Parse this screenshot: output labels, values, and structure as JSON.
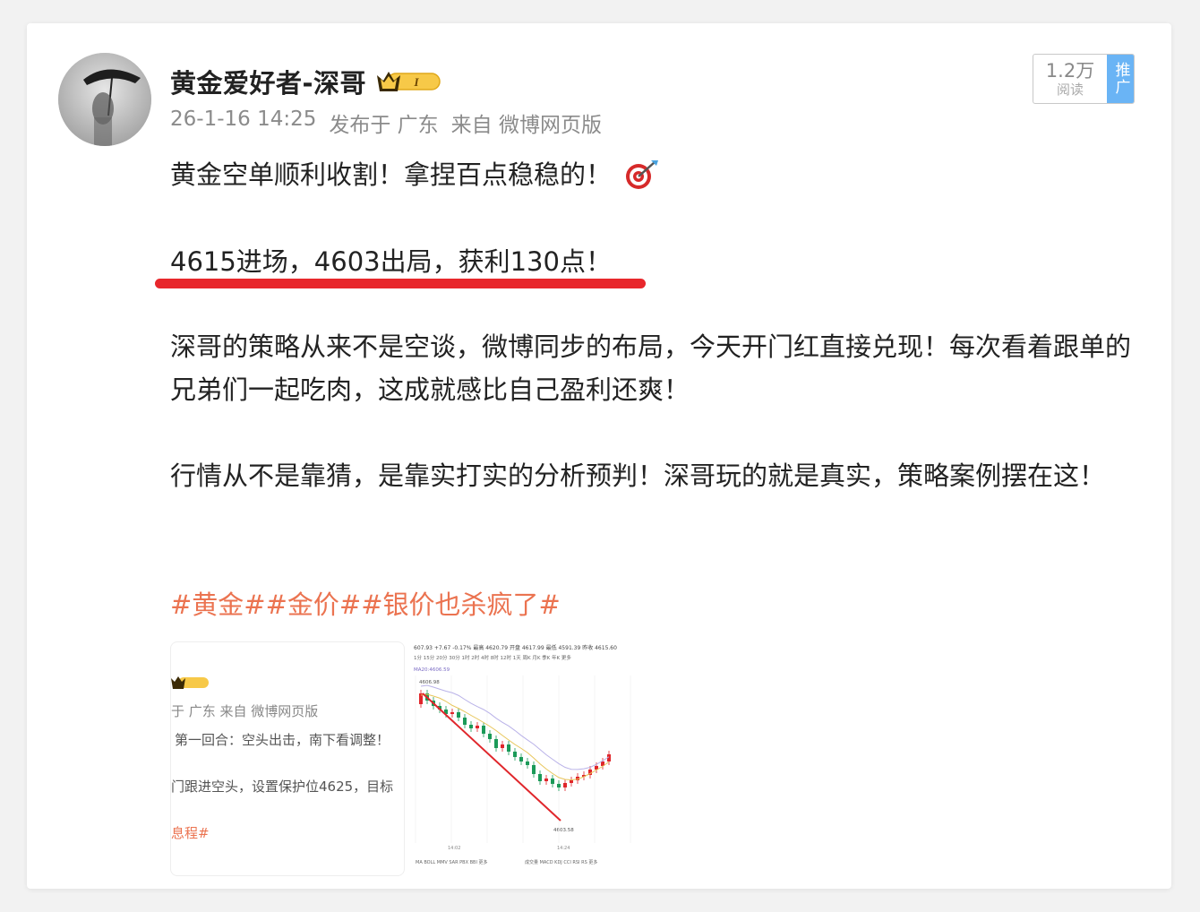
{
  "author": {
    "name": "黄金爱好者-深哥",
    "vip_level": "I"
  },
  "meta": {
    "time": "26-1-16 14:25",
    "location": "发布于 广东",
    "source": "来自 微博网页版"
  },
  "read_stats": {
    "count": "1.2万",
    "label": "阅读",
    "promote": "推广"
  },
  "content": {
    "line1": "黄金空单顺利收割！拿捏百点稳稳的！",
    "line2": "4615进场，4603出局，获利130点！",
    "para1": "深哥的策略从来不是空谈，微博同步的布局，今天开门红直接兑现！每次看着跟单的兄弟们一起吃肉，这成就感比自己盈利还爽！",
    "para2": "行情从不是靠猜，是靠实打实的分析预判！深哥玩的就是真实，策略案例摆在这！",
    "hashtags": [
      "#黄金#",
      "#金价#",
      "#银价也杀疯了#"
    ]
  },
  "thumb1": {
    "meta": "于 广东  来自 微博网页版",
    "line1": "第一回合：空头出击，南下看调整！",
    "line2": "门跟进空头，设置保护位4625，目标",
    "tag": "息程#"
  },
  "thumb2": {
    "header": "607.93  +7.67  -0.17%  最高 4620.79  开盘 4617.99  最低 4591.39  昨收 4615.60",
    "periods": "1分 15分 20分 30分 1时 2时 4时 8时 12时 1天 周K 月K 季K 年K 更多",
    "ma_label": "MA20:4606.59",
    "high_label": "4606.98",
    "low_label": "4603.58",
    "time1": "14:02",
    "time2": "14:24",
    "indicators_left": "MA BOLL MMV SAR PBX BBI 更多",
    "indicators_right": "成交量 MACD KDJ CCI RSI RS 更多"
  }
}
